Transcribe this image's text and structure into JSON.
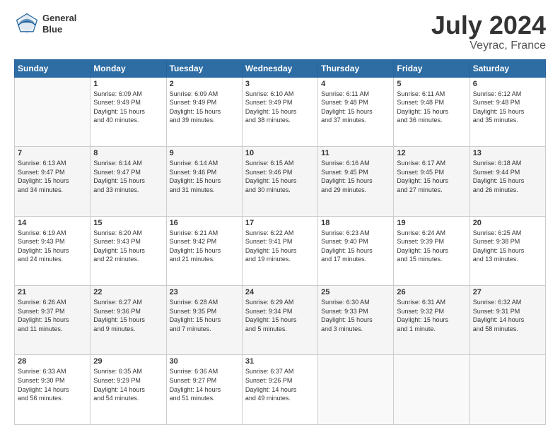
{
  "header": {
    "logo_line1": "General",
    "logo_line2": "Blue",
    "title": "July 2024",
    "subtitle": "Veyrac, France"
  },
  "calendar": {
    "days_of_week": [
      "Sunday",
      "Monday",
      "Tuesday",
      "Wednesday",
      "Thursday",
      "Friday",
      "Saturday"
    ],
    "weeks": [
      [
        {
          "day": "",
          "info": ""
        },
        {
          "day": "1",
          "info": "Sunrise: 6:09 AM\nSunset: 9:49 PM\nDaylight: 15 hours\nand 40 minutes."
        },
        {
          "day": "2",
          "info": "Sunrise: 6:09 AM\nSunset: 9:49 PM\nDaylight: 15 hours\nand 39 minutes."
        },
        {
          "day": "3",
          "info": "Sunrise: 6:10 AM\nSunset: 9:49 PM\nDaylight: 15 hours\nand 38 minutes."
        },
        {
          "day": "4",
          "info": "Sunrise: 6:11 AM\nSunset: 9:48 PM\nDaylight: 15 hours\nand 37 minutes."
        },
        {
          "day": "5",
          "info": "Sunrise: 6:11 AM\nSunset: 9:48 PM\nDaylight: 15 hours\nand 36 minutes."
        },
        {
          "day": "6",
          "info": "Sunrise: 6:12 AM\nSunset: 9:48 PM\nDaylight: 15 hours\nand 35 minutes."
        }
      ],
      [
        {
          "day": "7",
          "info": "Sunrise: 6:13 AM\nSunset: 9:47 PM\nDaylight: 15 hours\nand 34 minutes."
        },
        {
          "day": "8",
          "info": "Sunrise: 6:14 AM\nSunset: 9:47 PM\nDaylight: 15 hours\nand 33 minutes."
        },
        {
          "day": "9",
          "info": "Sunrise: 6:14 AM\nSunset: 9:46 PM\nDaylight: 15 hours\nand 31 minutes."
        },
        {
          "day": "10",
          "info": "Sunrise: 6:15 AM\nSunset: 9:46 PM\nDaylight: 15 hours\nand 30 minutes."
        },
        {
          "day": "11",
          "info": "Sunrise: 6:16 AM\nSunset: 9:45 PM\nDaylight: 15 hours\nand 29 minutes."
        },
        {
          "day": "12",
          "info": "Sunrise: 6:17 AM\nSunset: 9:45 PM\nDaylight: 15 hours\nand 27 minutes."
        },
        {
          "day": "13",
          "info": "Sunrise: 6:18 AM\nSunset: 9:44 PM\nDaylight: 15 hours\nand 26 minutes."
        }
      ],
      [
        {
          "day": "14",
          "info": "Sunrise: 6:19 AM\nSunset: 9:43 PM\nDaylight: 15 hours\nand 24 minutes."
        },
        {
          "day": "15",
          "info": "Sunrise: 6:20 AM\nSunset: 9:43 PM\nDaylight: 15 hours\nand 22 minutes."
        },
        {
          "day": "16",
          "info": "Sunrise: 6:21 AM\nSunset: 9:42 PM\nDaylight: 15 hours\nand 21 minutes."
        },
        {
          "day": "17",
          "info": "Sunrise: 6:22 AM\nSunset: 9:41 PM\nDaylight: 15 hours\nand 19 minutes."
        },
        {
          "day": "18",
          "info": "Sunrise: 6:23 AM\nSunset: 9:40 PM\nDaylight: 15 hours\nand 17 minutes."
        },
        {
          "day": "19",
          "info": "Sunrise: 6:24 AM\nSunset: 9:39 PM\nDaylight: 15 hours\nand 15 minutes."
        },
        {
          "day": "20",
          "info": "Sunrise: 6:25 AM\nSunset: 9:38 PM\nDaylight: 15 hours\nand 13 minutes."
        }
      ],
      [
        {
          "day": "21",
          "info": "Sunrise: 6:26 AM\nSunset: 9:37 PM\nDaylight: 15 hours\nand 11 minutes."
        },
        {
          "day": "22",
          "info": "Sunrise: 6:27 AM\nSunset: 9:36 PM\nDaylight: 15 hours\nand 9 minutes."
        },
        {
          "day": "23",
          "info": "Sunrise: 6:28 AM\nSunset: 9:35 PM\nDaylight: 15 hours\nand 7 minutes."
        },
        {
          "day": "24",
          "info": "Sunrise: 6:29 AM\nSunset: 9:34 PM\nDaylight: 15 hours\nand 5 minutes."
        },
        {
          "day": "25",
          "info": "Sunrise: 6:30 AM\nSunset: 9:33 PM\nDaylight: 15 hours\nand 3 minutes."
        },
        {
          "day": "26",
          "info": "Sunrise: 6:31 AM\nSunset: 9:32 PM\nDaylight: 15 hours\nand 1 minute."
        },
        {
          "day": "27",
          "info": "Sunrise: 6:32 AM\nSunset: 9:31 PM\nDaylight: 14 hours\nand 58 minutes."
        }
      ],
      [
        {
          "day": "28",
          "info": "Sunrise: 6:33 AM\nSunset: 9:30 PM\nDaylight: 14 hours\nand 56 minutes."
        },
        {
          "day": "29",
          "info": "Sunrise: 6:35 AM\nSunset: 9:29 PM\nDaylight: 14 hours\nand 54 minutes."
        },
        {
          "day": "30",
          "info": "Sunrise: 6:36 AM\nSunset: 9:27 PM\nDaylight: 14 hours\nand 51 minutes."
        },
        {
          "day": "31",
          "info": "Sunrise: 6:37 AM\nSunset: 9:26 PM\nDaylight: 14 hours\nand 49 minutes."
        },
        {
          "day": "",
          "info": ""
        },
        {
          "day": "",
          "info": ""
        },
        {
          "day": "",
          "info": ""
        }
      ]
    ]
  }
}
